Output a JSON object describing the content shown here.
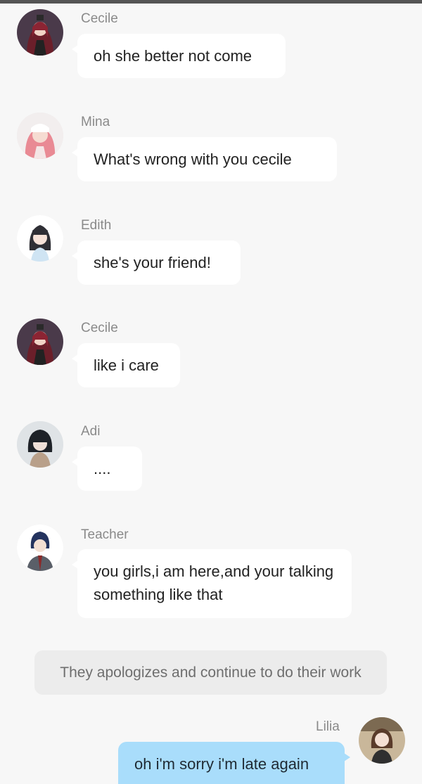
{
  "messages": [
    {
      "sender": "Cecile",
      "text": "oh she better not come",
      "avatar": "cecile-avatar"
    },
    {
      "sender": "Mina",
      "text": "What's wrong with you cecile",
      "avatar": "mina-avatar"
    },
    {
      "sender": "Edith",
      "text": "she's your friend!",
      "avatar": "edith-avatar"
    },
    {
      "sender": "Cecile",
      "text": "like i care",
      "avatar": "cecile-avatar"
    },
    {
      "sender": "Adi",
      "text": "....",
      "avatar": "adi-avatar"
    },
    {
      "sender": "Teacher",
      "text": "you girls,i am here,and your talking something like that",
      "avatar": "teacher-avatar"
    }
  ],
  "narration": "They apologizes and continue to do their work",
  "own_message": {
    "sender": "Lilia",
    "text": "oh i'm sorry i'm late again",
    "avatar": "lilia-avatar"
  },
  "colors": {
    "incoming_bubble": "#ffffff",
    "outgoing_bubble": "#a9ddfb",
    "background": "#f7f7f7",
    "narration_bg": "#ececec"
  }
}
